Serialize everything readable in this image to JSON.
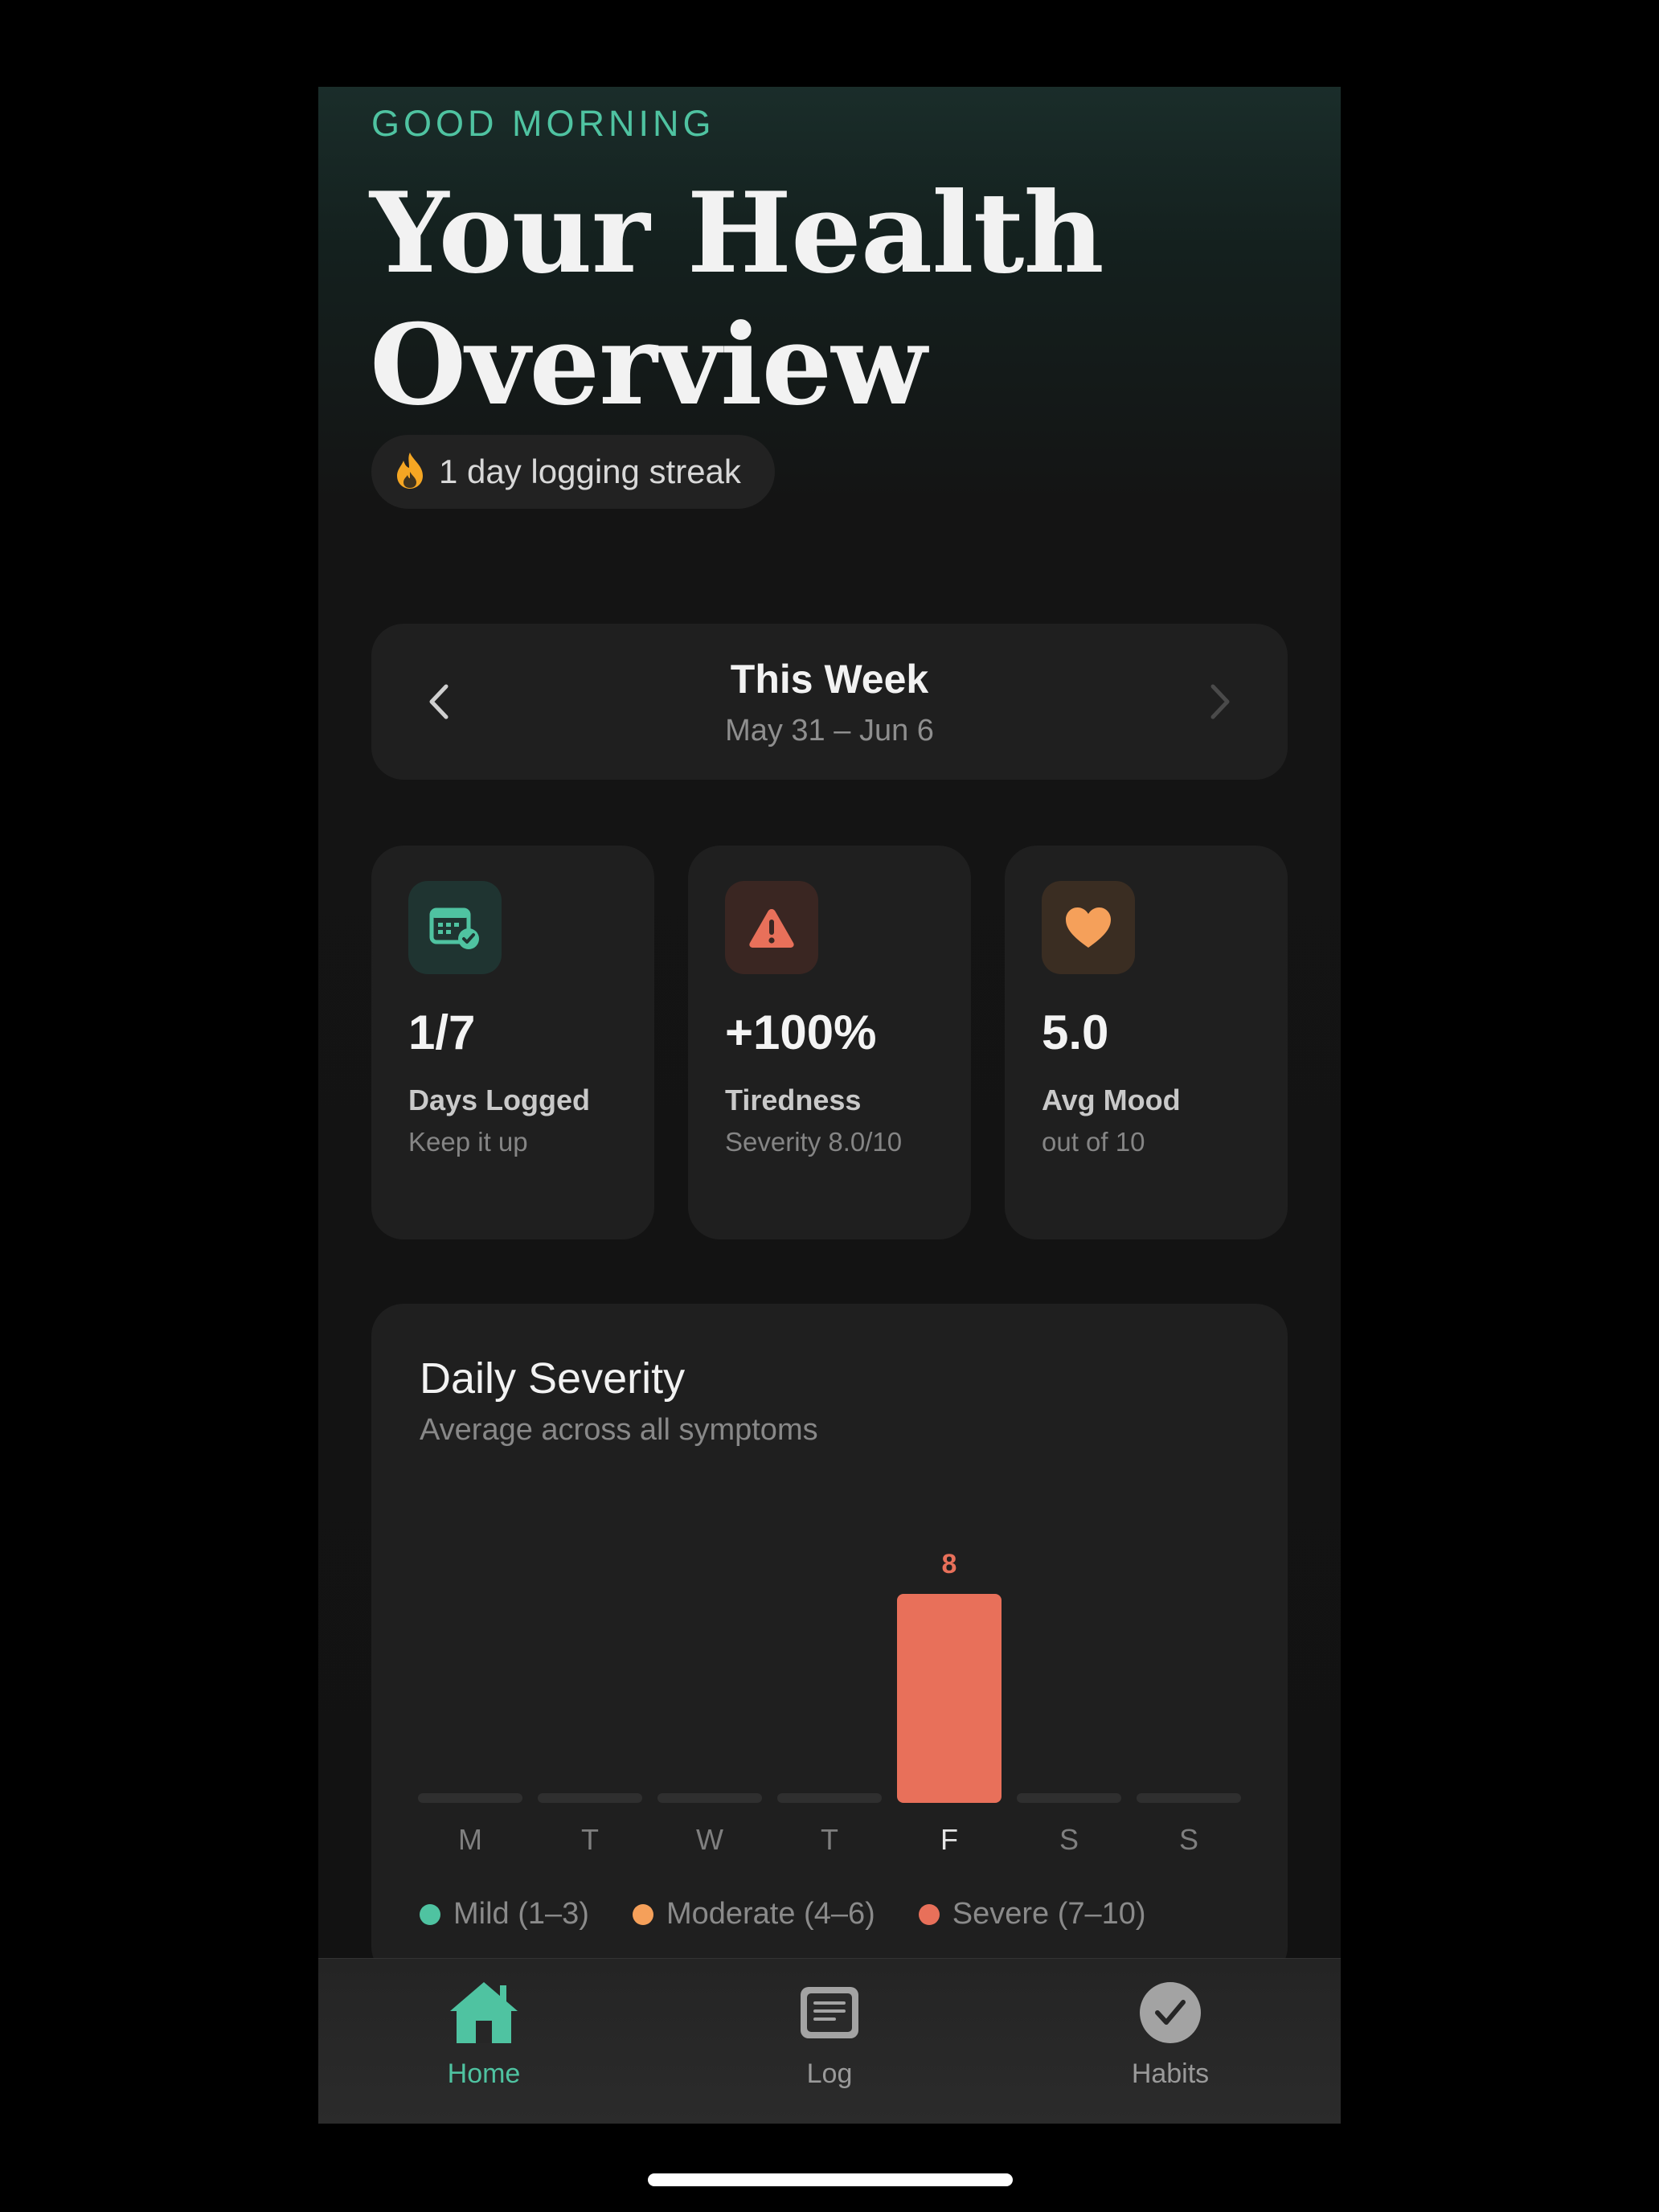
{
  "header": {
    "greeting": "GOOD MORNING",
    "title": "Your Health Overview",
    "streak": {
      "icon": "fire-icon",
      "text": "1 day logging streak"
    }
  },
  "week_selector": {
    "title": "This Week",
    "range": "May 31 – Jun 6",
    "prev_icon": "chevron-left-icon",
    "next_icon": "chevron-right-icon"
  },
  "stats": [
    {
      "icon": "calendar-check-icon",
      "value": "1/7",
      "label": "Days Logged",
      "sub": "Keep it up",
      "accent": "#4fc3a1"
    },
    {
      "icon": "warning-icon",
      "value": "+100%",
      "label": "Tiredness",
      "sub": "Severity 8.0/10",
      "accent": "#e8705a"
    },
    {
      "icon": "heart-icon",
      "value": "5.0",
      "label": "Avg Mood",
      "sub": "out of 10",
      "accent": "#f5a05a"
    }
  ],
  "chart_card": {
    "title": "Daily Severity",
    "subtitle": "Average across all symptoms"
  },
  "chart_data": {
    "type": "bar",
    "categories": [
      "M",
      "T",
      "W",
      "T",
      "F",
      "S",
      "S"
    ],
    "values": [
      null,
      null,
      null,
      null,
      8,
      null,
      null
    ],
    "data_labels": [
      "",
      "",
      "",
      "",
      "8",
      "",
      ""
    ],
    "ylim": [
      0,
      10
    ],
    "highlight_index": 4,
    "legend": [
      {
        "label": "Mild (1–3)",
        "color": "#4fc3a1"
      },
      {
        "label": "Moderate (4–6)",
        "color": "#f5a05a"
      },
      {
        "label": "Severe (7–10)",
        "color": "#e8705a"
      }
    ]
  },
  "tabbar": {
    "tabs": [
      {
        "label": "Home",
        "icon": "home-icon",
        "active": true
      },
      {
        "label": "Log",
        "icon": "document-icon",
        "active": false
      },
      {
        "label": "Habits",
        "icon": "checkmark-circle-icon",
        "active": false
      }
    ]
  },
  "colors": {
    "accent": "#4fc3a1",
    "severe": "#e8705a",
    "moderate": "#f5a05a",
    "card_bg": "#1f1f1f"
  }
}
